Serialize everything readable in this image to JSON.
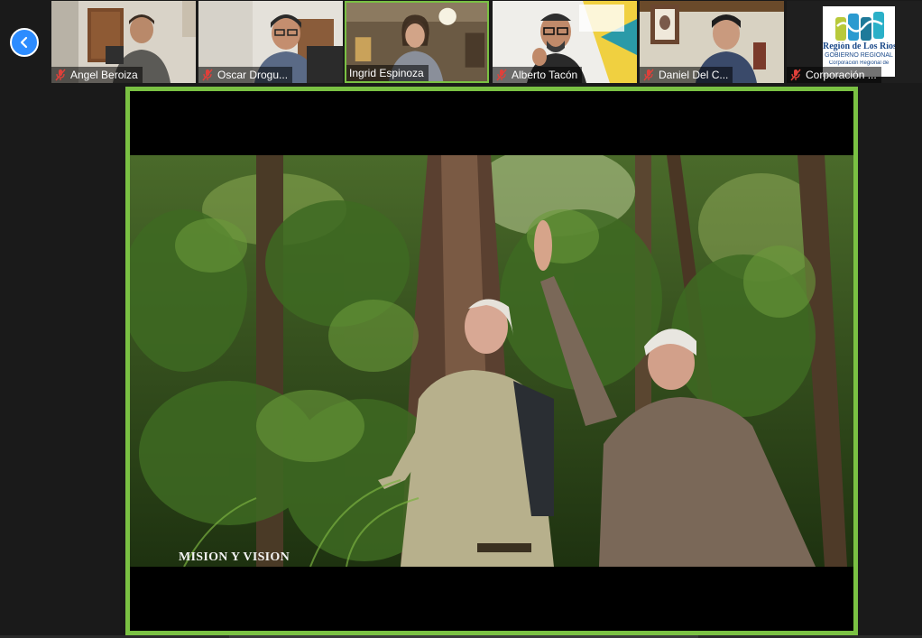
{
  "participants": [
    {
      "name": "Angel Beroiza",
      "muted": true
    },
    {
      "name": "Oscar Drogu...",
      "muted": true
    },
    {
      "name": "Ingrid Espinoza",
      "muted": false,
      "active_speaker": true
    },
    {
      "name": "Alberto Tacón",
      "muted": true
    },
    {
      "name": "Daniel Del C...",
      "muted": true
    },
    {
      "name": "Corporación ...",
      "muted": true
    }
  ],
  "logo": {
    "line1": "Región de Los Ríos",
    "line2": "GOBIERNO REGIONAL",
    "line3": "Corporación Regional de"
  },
  "share": {
    "caption": "MISION Y VISION"
  },
  "colors": {
    "active_border": "#7ac143",
    "nav_button": "#2d8cff",
    "mute_icon": "#e0403a"
  },
  "icons": {
    "prev": "chevron-left-icon",
    "mute": "microphone-muted-icon"
  }
}
